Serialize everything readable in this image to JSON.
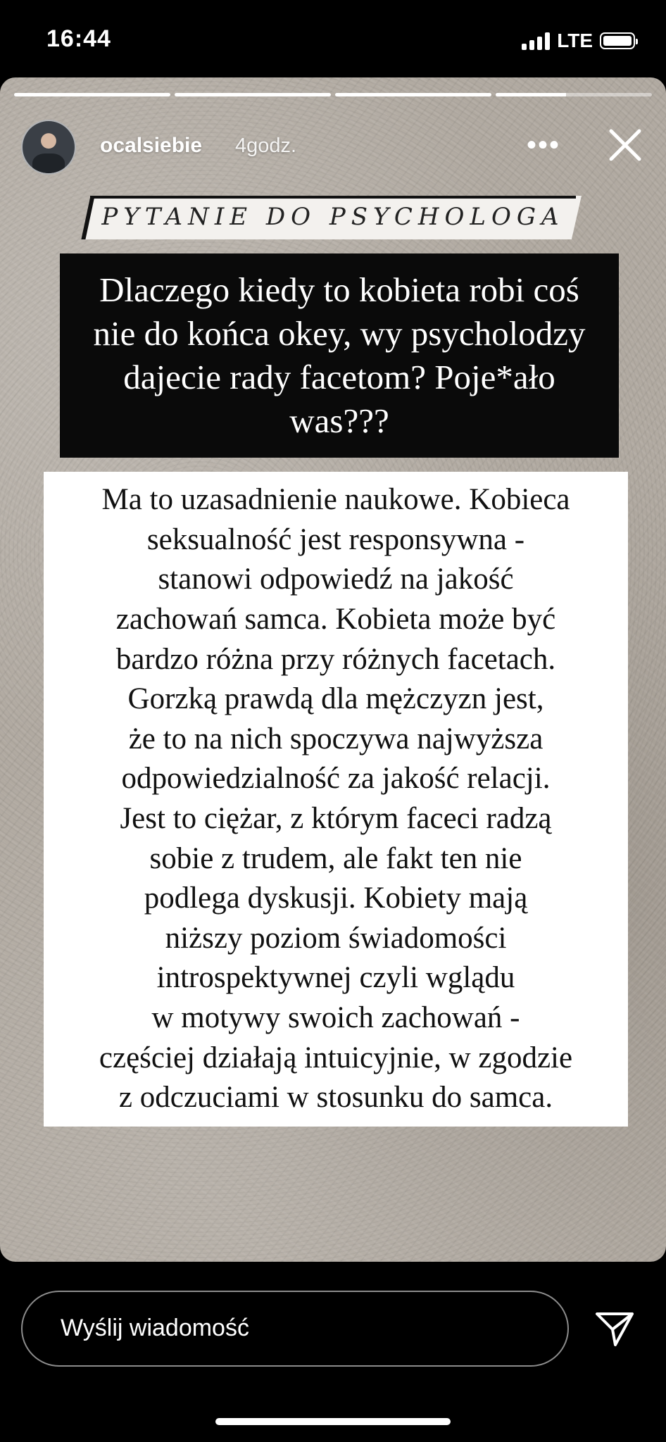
{
  "status_bar": {
    "time": "16:44",
    "network": "LTE",
    "signal_bars": 4,
    "battery_level": 1.0
  },
  "story": {
    "progress_segments": [
      1.0,
      1.0,
      1.0,
      0.45
    ],
    "username": "ocalsiebie",
    "time_ago": "4godz.",
    "more_label": "•••",
    "topic": "PYTANIE DO PSYCHOLOGA",
    "question": "Dlaczego kiedy to kobieta robi coś nie do końca okey, wy psycholodzy dajecie rady facetom? Poje*ało was???",
    "answer": "Ma to uzasadnienie naukowe. Kobieca\nseksualność jest responsywna -\nstanowi odpowiedź na jakość\nzachowań samca. Kobieta może być\nbardzo różna przy różnych facetach.\nGorzką prawdą dla mężczyzn jest,\nże to na nich spoczywa najwyższa\nodpowiedzialność za jakość relacji.\nJest to ciężar, z którym faceci radzą\nsobie z trudem, ale fakt ten nie\npodlega dyskusji. Kobiety mają\nniższy poziom świadomości\nintrospektywnej czyli wglądu\nw motywy swoich zachowań -\nczęściej działają intuicyjnie, w zgodzie\nz odczuciami w stosunku do samca."
  },
  "reply": {
    "placeholder": "Wyślij wiadomość"
  },
  "icons": {
    "avatar": "profile-photo",
    "more": "more-icon",
    "close": "close-icon",
    "send": "send-icon"
  }
}
